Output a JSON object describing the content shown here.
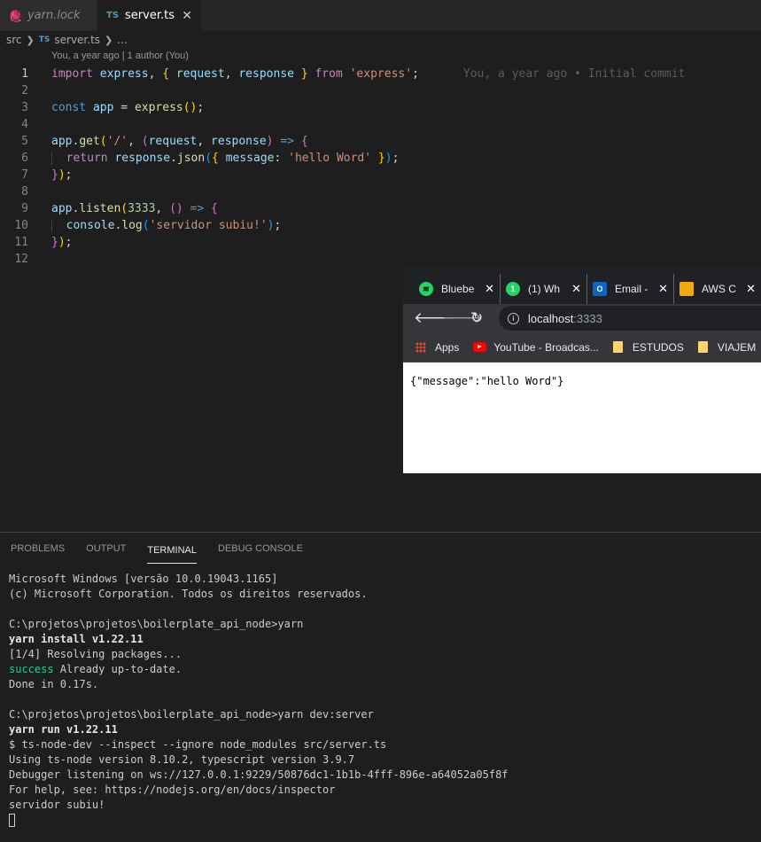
{
  "tabs": [
    {
      "label": "yarn.lock",
      "active": false
    },
    {
      "label": "server.ts",
      "active": true,
      "lang": "TS"
    }
  ],
  "breadcrumb": {
    "folder": "src",
    "lang": "TS",
    "file": "server.ts",
    "more": "..."
  },
  "codelens": "You, a year ago | 1 author (You)",
  "blame": "You, a year ago • Initial commit",
  "code_lines": [
    "import express, { request, response } from 'express';",
    "",
    "const app = express();",
    "",
    "app.get('/', (request, response) => {",
    "  return response.json({ message: 'hello Word' });",
    "});",
    "",
    "app.listen(3333, () => {",
    "  console.log('servidor subiu!');",
    "});",
    ""
  ],
  "browser": {
    "tabs": [
      {
        "title": "Bluebe",
        "icon": "spotify-icon",
        "color": "#1ed760"
      },
      {
        "title": "(1) Wh",
        "icon": "whatsapp-icon",
        "color": "#25d366"
      },
      {
        "title": "Email -",
        "icon": "outlook-icon",
        "color": "#0a64c9"
      },
      {
        "title": "AWS C",
        "icon": "aws-icon",
        "color": "#f7a80d"
      }
    ],
    "host": "localhost",
    "port": ":3333",
    "bookmarks": {
      "apps": "Apps",
      "youtube": "YouTube - Broadcas...",
      "folder1": "ESTUDOS",
      "folder2": "VIAJEM"
    },
    "content": "{\"message\":\"hello Word\"}"
  },
  "panel_tabs": [
    "PROBLEMS",
    "OUTPUT",
    "TERMINAL",
    "DEBUG CONSOLE"
  ],
  "terminal": {
    "l1": "Microsoft Windows [versão 10.0.19043.1165]",
    "l2": "(c) Microsoft Corporation. Todos os direitos reservados.",
    "l3": "C:\\projetos\\projetos\\boilerplate_api_node>yarn",
    "l4": "yarn install v1.22.11",
    "l5": "[1/4] Resolving packages...",
    "l6a": "success",
    "l6b": " Already up-to-date.",
    "l7": "Done in 0.17s.",
    "l8": "C:\\projetos\\projetos\\boilerplate_api_node>yarn dev:server",
    "l9": "yarn run v1.22.11",
    "l10": "$ ts-node-dev --inspect --ignore node_modules src/server.ts",
    "l11": "Using ts-node version 8.10.2, typescript version 3.9.7",
    "l12": "Debugger listening on ws://127.0.0.1:9229/50876dc1-1b1b-4fff-896e-a64052a05f8f",
    "l13": "For help, see: https://nodejs.org/en/docs/inspector",
    "l14": "servidor subiu!"
  }
}
